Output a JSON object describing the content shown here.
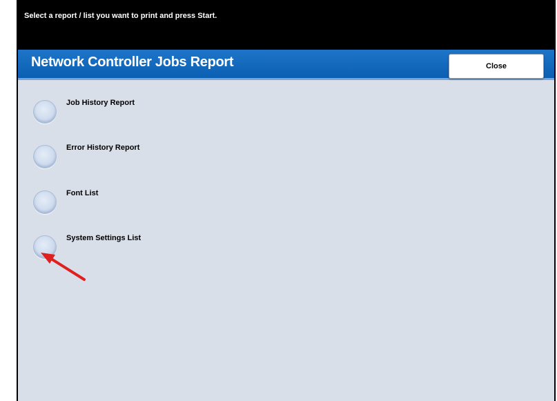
{
  "instruction": "Select a report / list you want to print and press Start.",
  "header": {
    "title": "Network Controller Jobs Report",
    "close_label": "Close"
  },
  "options": [
    {
      "label": "Job History Report",
      "selected": false
    },
    {
      "label": "Error History Report",
      "selected": false
    },
    {
      "label": "Font List",
      "selected": false
    },
    {
      "label": "System Settings List",
      "selected": false
    }
  ],
  "colors": {
    "title_bar": "#0b5fb3",
    "background": "#d9dfe9",
    "annotation_arrow": "#e02020"
  }
}
